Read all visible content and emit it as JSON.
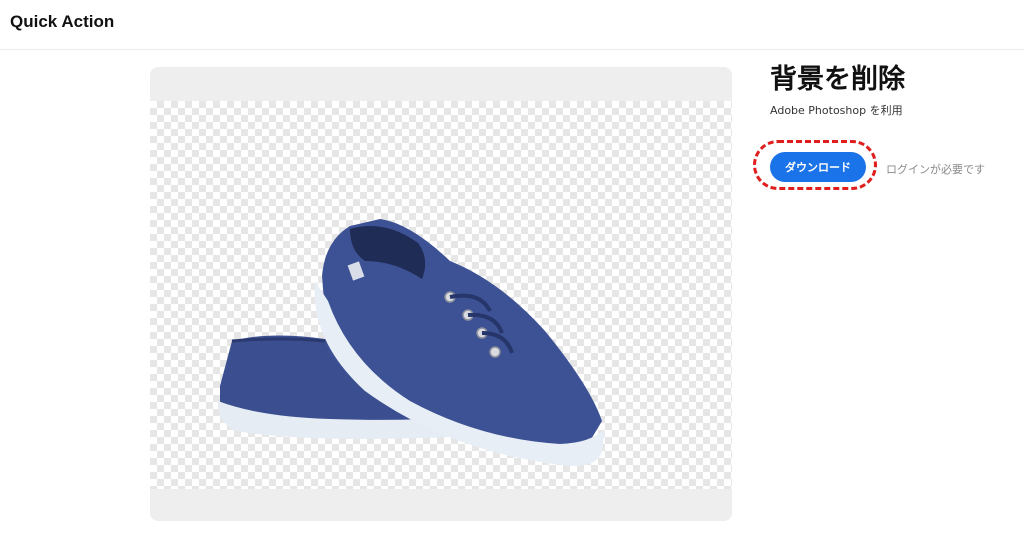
{
  "header": {
    "title": "Quick Action"
  },
  "preview": {
    "image_subject": "blue-canvas-sneakers",
    "background": "transparent-checkerboard",
    "colors": {
      "shoe": "#3a4f8f",
      "sole": "#e9eef5",
      "card": "#eeeeee"
    }
  },
  "panel": {
    "title": "背景を削除",
    "subtitle": "Adobe Photoshop を利用",
    "download_label": "ダウンロード",
    "login_note": "ログインが必要です",
    "accent_color": "#1a73e8",
    "highlight_color": "#e01e1e"
  }
}
